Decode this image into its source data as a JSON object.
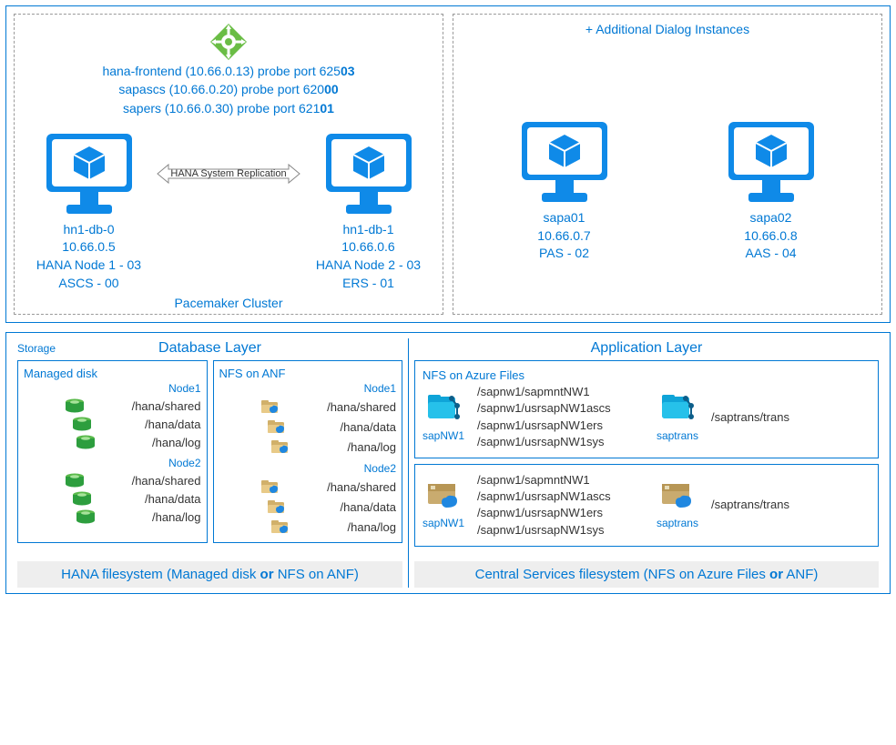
{
  "top": {
    "lb_lines": {
      "l1a": "hana-frontend (10.66.0.13) probe port 625",
      "l1b": "03",
      "l2a": "sapascs (10.66.0.20) probe port 620",
      "l2b": "00",
      "l3a": "sapers (10.66.0.30) probe port 621",
      "l3b": "01"
    },
    "replication_label": "HANA System Replication",
    "cluster_label": "Pacemaker Cluster",
    "node1": {
      "host": "hn1-db-0",
      "ip": "10.66.0.5",
      "role": "HANA Node 1 - 03",
      "instance": "ASCS - 00"
    },
    "node2": {
      "host": "hn1-db-1",
      "ip": "10.66.0.6",
      "role": "HANA Node 2 - 03",
      "instance": "ERS - 01"
    },
    "dialog_title": "+ Additional Dialog Instances",
    "app1": {
      "host": "sapa01",
      "ip": "10.66.0.7",
      "role": "PAS - 02"
    },
    "app2": {
      "host": "sapa02",
      "ip": "10.66.0.8",
      "role": "AAS - 04"
    }
  },
  "storage": {
    "storage_label": "Storage",
    "db": {
      "title": "Database Layer",
      "managed_title": "Managed disk",
      "nfsanf_title": "NFS on ANF",
      "node1": "Node1",
      "node2": "Node2",
      "fs": {
        "shared": "/hana/shared",
        "data": "/hana/data",
        "log": "/hana/log"
      },
      "footer_a": "HANA filesystem (Managed disk ",
      "footer_b": "or",
      "footer_c": " NFS on ANF)"
    },
    "app": {
      "title": "Application Layer",
      "nfsfiles_title": "NFS on Azure Files",
      "share1_name": "sapNW1",
      "share1_paths": {
        "p1": "/sapnw1/sapmntNW1",
        "p2": "/sapnw1/usrsapNW1ascs",
        "p3": "/sapnw1/usrsapNW1ers",
        "p4": "/sapnw1/usrsapNW1sys"
      },
      "share2_name": "saptrans",
      "share2_path": "/saptrans/trans",
      "footer_a": "Central Services filesystem (NFS on Azure Files ",
      "footer_b": "or",
      "footer_c": " ANF)"
    }
  }
}
